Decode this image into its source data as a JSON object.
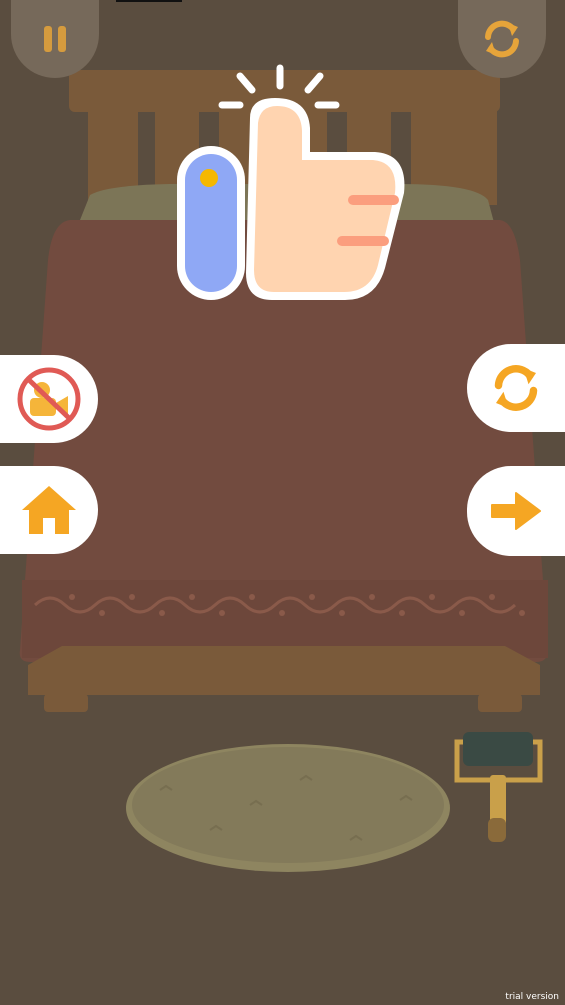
{
  "watermark": "trial version",
  "buttons": {
    "pause": {
      "icon": "pause-icon"
    },
    "restart_top": {
      "icon": "restart-icon"
    },
    "no_ads": {
      "icon": "no-video-ads-icon"
    },
    "home": {
      "icon": "home-icon"
    },
    "replay": {
      "icon": "replay-icon"
    },
    "next": {
      "icon": "arrow-right-icon"
    }
  },
  "overlay": {
    "icon": "thumbs-up-icon"
  },
  "colors": {
    "background": "#5a4d3f",
    "accent": "#f5a623",
    "bedspread": "#724b3f",
    "bed_frame": "#7a5a3a",
    "pillow": "#7c7557",
    "rug": "#837a5a",
    "thumb_skin": "#ffd4b0",
    "thumb_sleeve": "#8fa8f5",
    "no_ads_red": "#e05a55"
  }
}
